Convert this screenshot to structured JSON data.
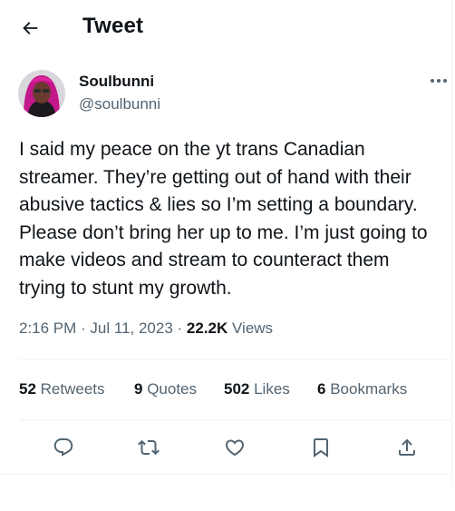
{
  "header": {
    "title": "Tweet",
    "back_icon": "arrow-left-icon"
  },
  "author": {
    "name": "Soulbunni",
    "handle": "@soulbunni",
    "more_icon": "ellipsis-icon"
  },
  "tweet": {
    "lines": [
      "I said my peace on the yt trans Canadian",
      "streamer. They’re getting out of hand with their",
      "abusive tactics & lies so I’m setting a boundary.",
      "Please don’t bring her up to me. I’m just going to",
      "make videos and stream to counteract them",
      "trying to stunt my growth."
    ]
  },
  "meta": {
    "time": "2:16 PM",
    "sep1": " · ",
    "date": "Jul 11, 2023",
    "sep2": " · ",
    "views_count": "22.2K",
    "views_label": " Views"
  },
  "stats": {
    "retweets": {
      "count": "52",
      "label": " Retweets"
    },
    "quotes": {
      "count": "9",
      "label": " Quotes"
    },
    "likes": {
      "count": "502",
      "label": " Likes"
    },
    "bookmarks": {
      "count": "6",
      "label": " Bookmarks"
    }
  },
  "actions": {
    "reply_icon": "reply-icon",
    "retweet_icon": "retweet-icon",
    "like_icon": "heart-icon",
    "bookmark_icon": "bookmark-icon",
    "share_icon": "share-icon"
  },
  "colors": {
    "text": "#0f1419",
    "secondary": "#536471",
    "divider": "#eff3f4",
    "background": "#ffffff"
  }
}
